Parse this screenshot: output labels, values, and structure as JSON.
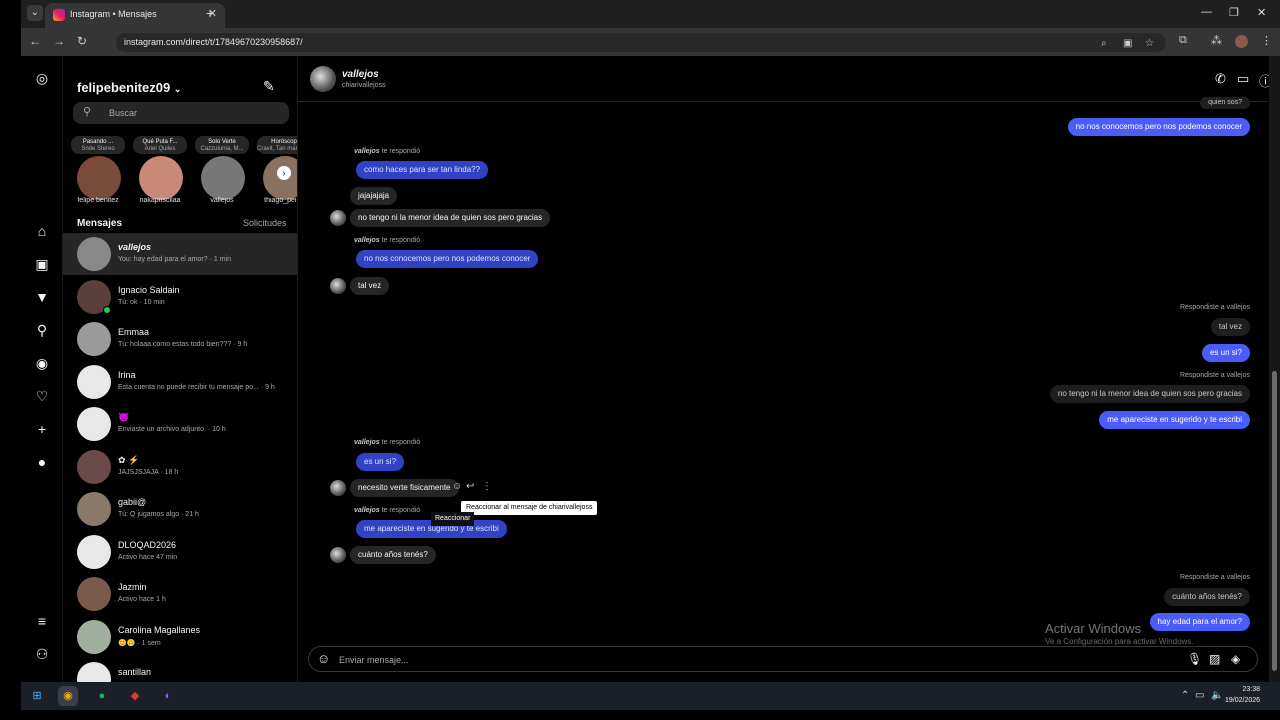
{
  "browser": {
    "tab_title": "Instagram • Mensajes",
    "url": "instagram.com/direct/t/17849670230958687/"
  },
  "sidebar": {
    "username": "felipebenitez09",
    "search_placeholder": "Buscar",
    "notes": [
      {
        "note": "Pasando ...",
        "note_sub": "Snde Stereo",
        "name": "felipe benitez",
        "color": "#7a4b3a"
      },
      {
        "note": "Qué Puta F...",
        "note_sub": "Ariel Quiles",
        "name": "nakapriscilaa",
        "color": "#c98a7a"
      },
      {
        "note": "Solo Verte",
        "note_sub": "Cazzulunia, M...",
        "name": "vallejos",
        "color": "#777777"
      },
      {
        "note": "Horóscop",
        "note_sub": "Cravit, Tan man yo pe c",
        "name": "thiago_peiuk",
        "color": "#8a7060"
      }
    ],
    "messages_label": "Mensajes",
    "requests_label": "Solicitudes",
    "conversations": [
      {
        "name": "vallejos",
        "sub": "You: hay edad para el amor? · 1 min",
        "color": "#888888",
        "active": true
      },
      {
        "name": "Ignacio Saldain",
        "sub": "Tú: ok · 10 min",
        "color": "#5a3f3a",
        "online": true
      },
      {
        "name": "Emmaa",
        "sub": "Tú: holaaa como estas todo bien??? · 9 h",
        "color": "#9a9a9a"
      },
      {
        "name": "Irina",
        "sub": "Esta cuenta no puede recibir tu mensaje po... · 9 h",
        "color": "#e8e8e8"
      },
      {
        "name": "😈",
        "sub": "Enviaste un archivo adjunto. · 10 h",
        "color": "#e8e8e8"
      },
      {
        "name": "✿ ⚡",
        "sub": "JAJSJSJAJA · 18 h",
        "color": "#6a4a4a"
      },
      {
        "name": "gabii@",
        "sub": "Tú: Q jugamos algo · 21 h",
        "color": "#8a7a6a"
      },
      {
        "name": "DLOQAD2026",
        "sub": "Activo hace 47 min",
        "color": "#e8e8e8"
      },
      {
        "name": "Jazmin",
        "sub": "Activo hace 1 h",
        "color": "#7a5a4a"
      },
      {
        "name": "Carolina Magallanes",
        "sub": "😊🙃 · 1 sem",
        "color": "#a0b0a0"
      },
      {
        "name": "santillan",
        "sub": "",
        "color": "#e8e8e8"
      }
    ]
  },
  "chat": {
    "name": "vallejos",
    "handle": "chiarivallejoss",
    "reply_label_in": "vallejos",
    "reply_label_in_suffix": " te respondió",
    "reply_label_out": "Respondiste a vallejos",
    "messages": {
      "m0": "quien sos?",
      "m1": "no nos conocemos pero nos podemos conocer",
      "m2q": "como haces para ser tan linda??",
      "m3": "jajajajaja",
      "m4": "no tengo ni la menor idea de quien sos pero gracias",
      "m5q": "no nos conocemos pero nos podemos conocer",
      "m6": "tal vez",
      "m7q": "tal vez",
      "m8": "es un si?",
      "m9q": "no tengo ni la menor idea de quien sos pero gracias",
      "m10": "me apareciste en sugerido y te escribi",
      "m11q": "es un si?",
      "m12": "necesito verte fisicamente",
      "m13q": "me apareciste en sugerido y te escribi",
      "m14": "cuánto años tenés?",
      "m15q": "cuánto años tenés?",
      "m16": "hay edad para el amor?"
    },
    "tooltip": "Reaccionar al mensaje de chiarivallejoss",
    "tooltip2": "Reaccionar",
    "composer_placeholder": "Enviar mensaje..."
  },
  "watermark": {
    "title": "Activar Windows",
    "subtitle": "Ve a Configuración para activar Windows."
  },
  "taskbar": {
    "time": "23:38",
    "date": "19/02/2026"
  }
}
